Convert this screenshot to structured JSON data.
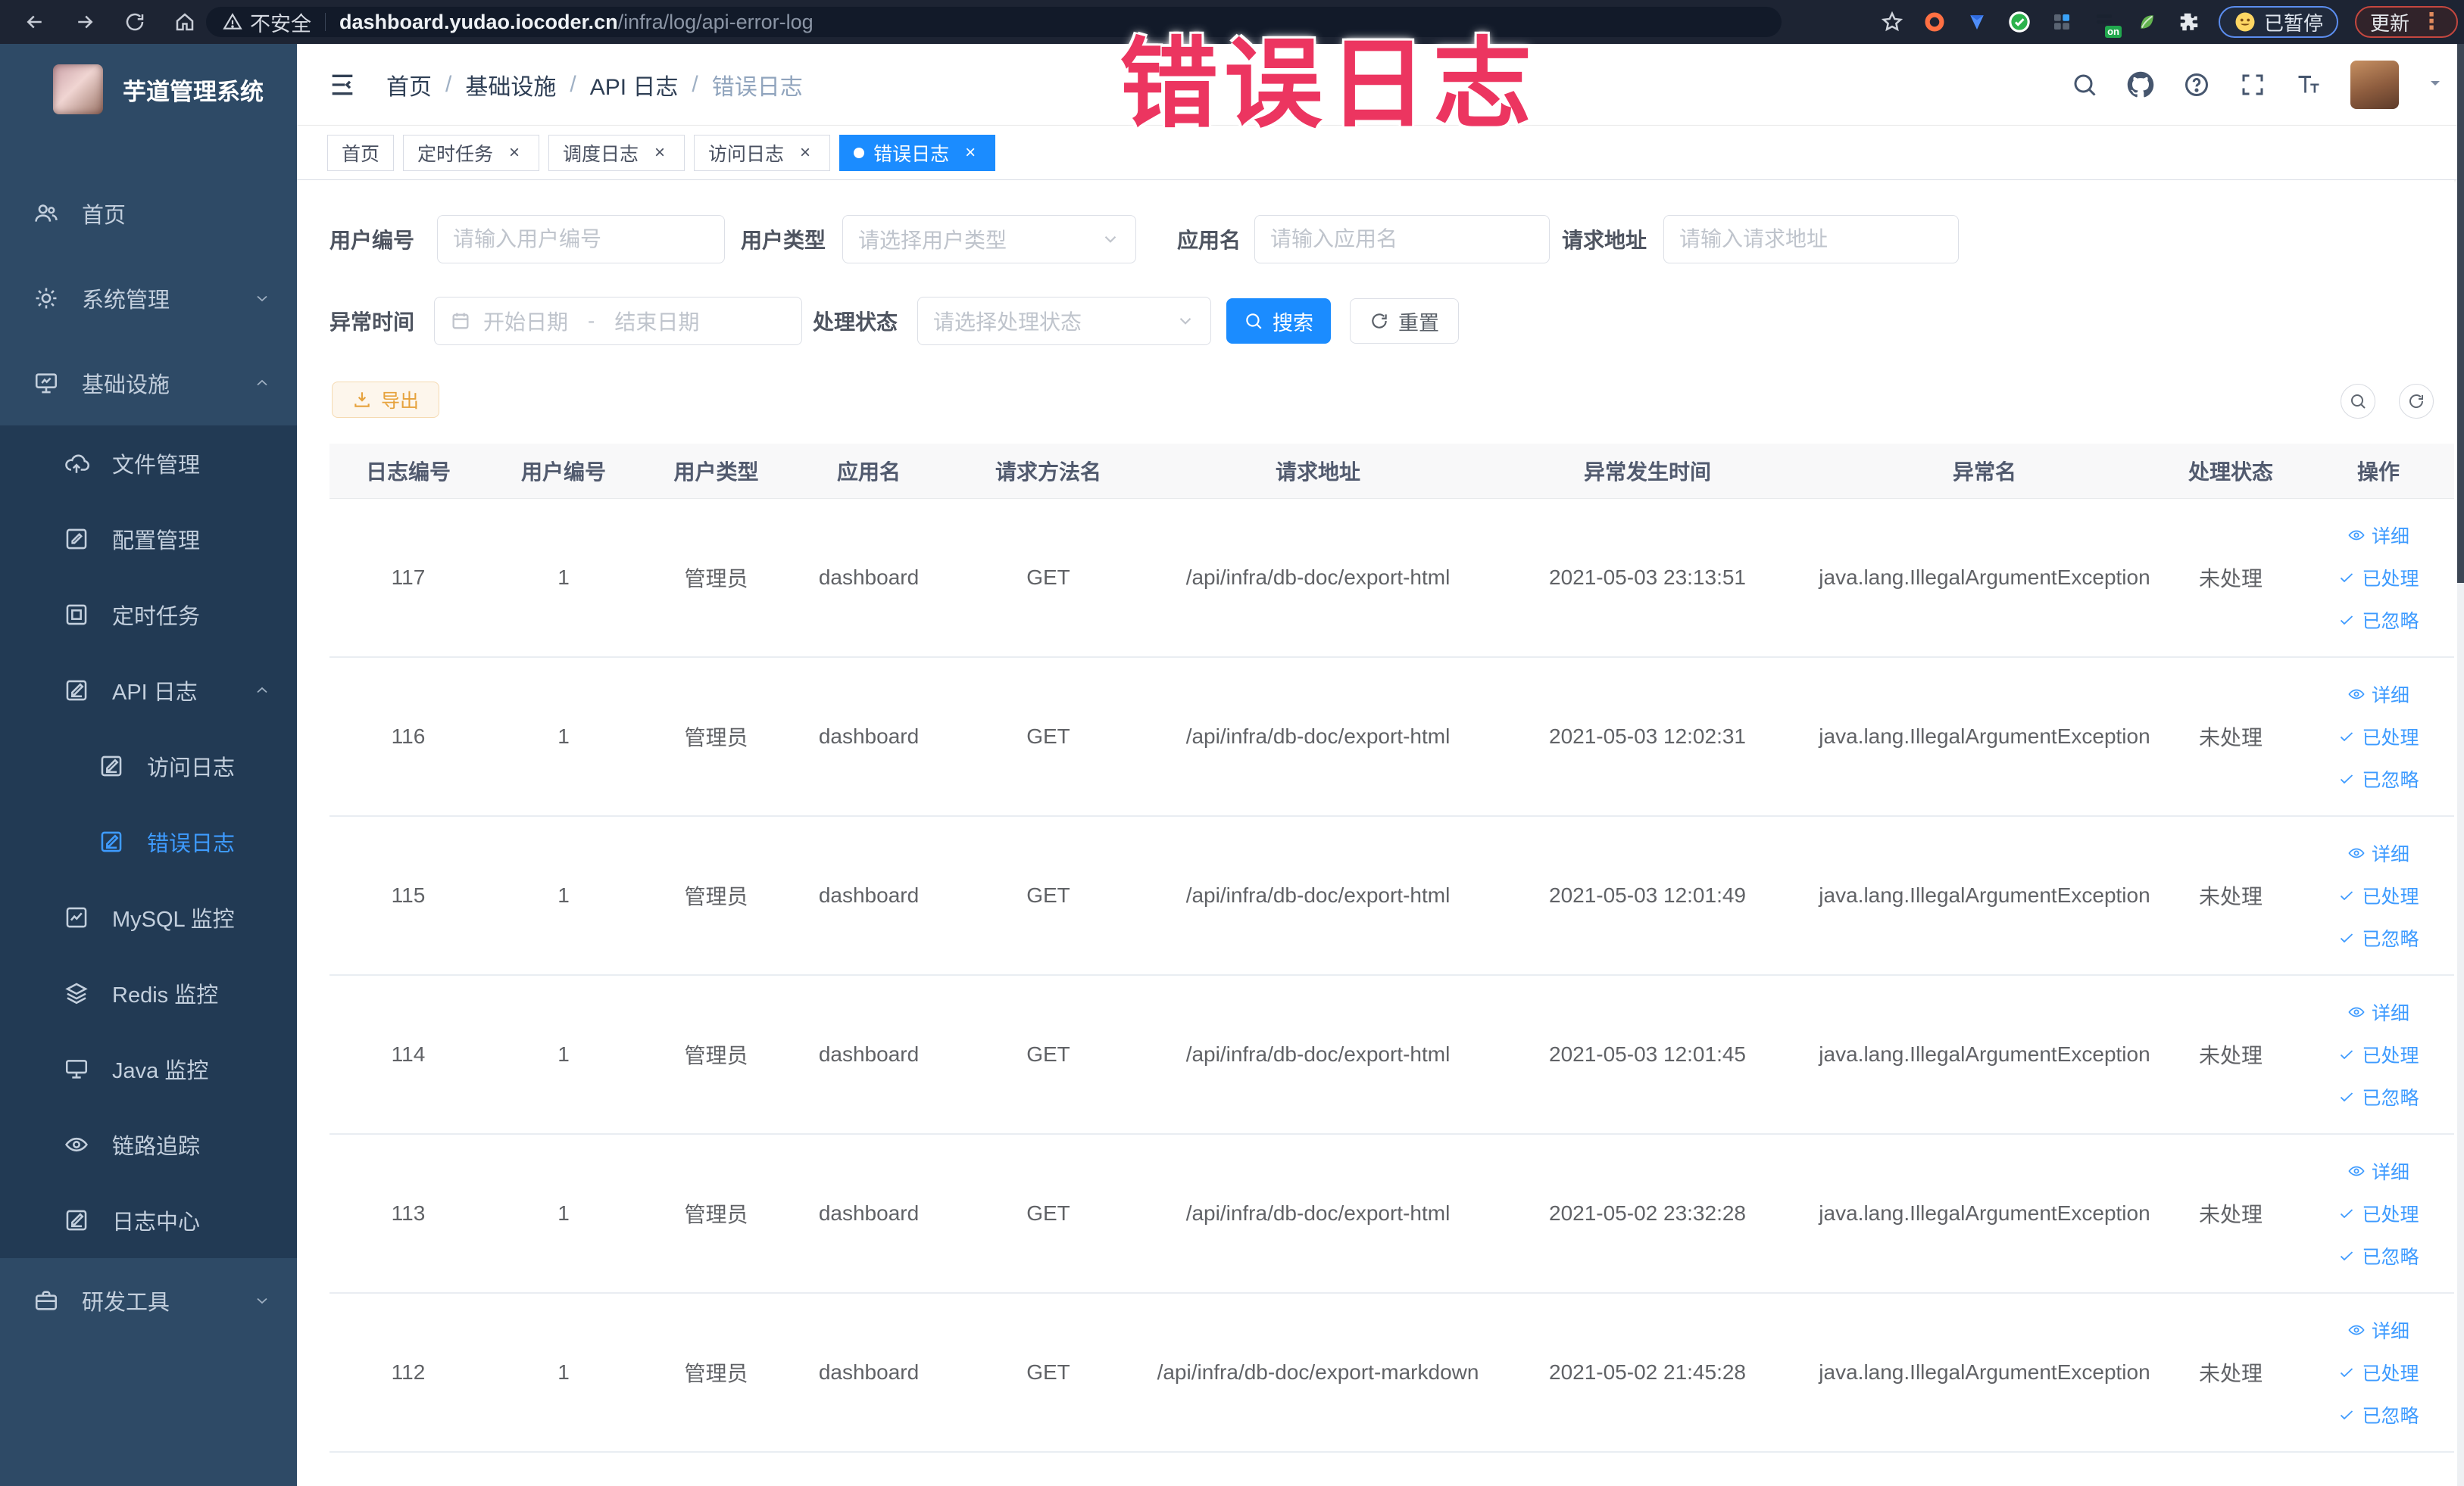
{
  "colors": {
    "accent": "#1b8cff",
    "link_blue": "#3e9bff",
    "annotation_red": "#ec3560",
    "warning_orange": "#e6a23c",
    "sidebar_bg": "#2e4a66",
    "sidebar_submenu_bg": "#223a54"
  },
  "annotation": {
    "text": "错误日志"
  },
  "browser": {
    "security_label": "不安全",
    "url_host": "dashboard.yudao.iocoder.cn",
    "url_path": "/infra/log/api-error-log",
    "paused_badge": "已暂停",
    "update_button": "更新"
  },
  "sidebar": {
    "logo_title": "芋道管理系统",
    "items": [
      {
        "label": "首页",
        "icon": "home-users-icon",
        "level": 1,
        "arrow": "",
        "active": false
      },
      {
        "label": "系统管理",
        "icon": "gear-icon",
        "level": 1,
        "arrow": "down",
        "active": false
      },
      {
        "label": "基础设施",
        "icon": "infra-monitor-icon",
        "level": 1,
        "arrow": "up",
        "active": false
      },
      {
        "label": "文件管理",
        "icon": "cloud-upload-icon",
        "level": 2,
        "arrow": "",
        "active": false
      },
      {
        "label": "配置管理",
        "icon": "edit-square-icon",
        "level": 2,
        "arrow": "",
        "active": false
      },
      {
        "label": "定时任务",
        "icon": "schedule-icon",
        "level": 2,
        "arrow": "",
        "active": false
      },
      {
        "label": "API 日志",
        "icon": "log-edit-icon",
        "level": 2,
        "arrow": "up",
        "active": false
      },
      {
        "label": "访问日志",
        "icon": "log-edit-icon",
        "level": 3,
        "arrow": "",
        "active": false
      },
      {
        "label": "错误日志",
        "icon": "log-edit-icon",
        "level": 3,
        "arrow": "",
        "active": true
      },
      {
        "label": "MySQL 监控",
        "icon": "chart-icon",
        "level": 2,
        "arrow": "",
        "active": false
      },
      {
        "label": "Redis 监控",
        "icon": "stack-icon",
        "level": 2,
        "arrow": "",
        "active": false
      },
      {
        "label": "Java 监控",
        "icon": "java-monitor-icon",
        "level": 2,
        "arrow": "",
        "active": false
      },
      {
        "label": "链路追踪",
        "icon": "eye-icon",
        "level": 2,
        "arrow": "",
        "active": false
      },
      {
        "label": "日志中心",
        "icon": "log-edit-icon",
        "level": 2,
        "arrow": "",
        "active": false
      },
      {
        "label": "研发工具",
        "icon": "briefcase-icon",
        "level": 1,
        "arrow": "down",
        "active": false
      }
    ]
  },
  "breadcrumb": {
    "items": [
      "首页",
      "基础设施",
      "API 日志",
      "错误日志"
    ]
  },
  "tabs": [
    {
      "label": "首页",
      "closable": false,
      "active": false
    },
    {
      "label": "定时任务",
      "closable": true,
      "active": false
    },
    {
      "label": "调度日志",
      "closable": true,
      "active": false
    },
    {
      "label": "访问日志",
      "closable": true,
      "active": false
    },
    {
      "label": "错误日志",
      "closable": true,
      "active": true
    }
  ],
  "filters": {
    "user_id": {
      "label": "用户编号",
      "placeholder": "请输入用户编号"
    },
    "user_type": {
      "label": "用户类型",
      "placeholder": "请选择用户类型"
    },
    "app_name": {
      "label": "应用名",
      "placeholder": "请输入应用名"
    },
    "request_url": {
      "label": "请求地址",
      "placeholder": "请输入请求地址"
    },
    "exception_time": {
      "label": "异常时间",
      "start_placeholder": "开始日期",
      "separator": "-",
      "end_placeholder": "结束日期"
    },
    "process_status": {
      "label": "处理状态",
      "placeholder": "请选择处理状态"
    },
    "search_button": "搜索",
    "reset_button": "重置"
  },
  "toolbar": {
    "export_button": "导出"
  },
  "table": {
    "columns": [
      "日志编号",
      "用户编号",
      "用户类型",
      "应用名",
      "请求方法名",
      "请求地址",
      "异常发生时间",
      "异常名",
      "处理状态",
      "操作"
    ],
    "action_labels": [
      "详细",
      "已处理",
      "已忽略"
    ],
    "rows": [
      {
        "id": "117",
        "user_id": "1",
        "user_type": "管理员",
        "app": "dashboard",
        "method": "GET",
        "url": "/api/infra/db-doc/export-html",
        "time": "2021-05-03 23:13:51",
        "exception": "java.lang.IllegalArgumentException",
        "status": "未处理"
      },
      {
        "id": "116",
        "user_id": "1",
        "user_type": "管理员",
        "app": "dashboard",
        "method": "GET",
        "url": "/api/infra/db-doc/export-html",
        "time": "2021-05-03 12:02:31",
        "exception": "java.lang.IllegalArgumentException",
        "status": "未处理"
      },
      {
        "id": "115",
        "user_id": "1",
        "user_type": "管理员",
        "app": "dashboard",
        "method": "GET",
        "url": "/api/infra/db-doc/export-html",
        "time": "2021-05-03 12:01:49",
        "exception": "java.lang.IllegalArgumentException",
        "status": "未处理"
      },
      {
        "id": "114",
        "user_id": "1",
        "user_type": "管理员",
        "app": "dashboard",
        "method": "GET",
        "url": "/api/infra/db-doc/export-html",
        "time": "2021-05-03 12:01:45",
        "exception": "java.lang.IllegalArgumentException",
        "status": "未处理"
      },
      {
        "id": "113",
        "user_id": "1",
        "user_type": "管理员",
        "app": "dashboard",
        "method": "GET",
        "url": "/api/infra/db-doc/export-html",
        "time": "2021-05-02 23:32:28",
        "exception": "java.lang.IllegalArgumentException",
        "status": "未处理"
      },
      {
        "id": "112",
        "user_id": "1",
        "user_type": "管理员",
        "app": "dashboard",
        "method": "GET",
        "url": "/api/infra/db-doc/export-markdown",
        "time": "2021-05-02 21:45:28",
        "exception": "java.lang.IllegalArgumentException",
        "status": "未处理"
      }
    ]
  }
}
